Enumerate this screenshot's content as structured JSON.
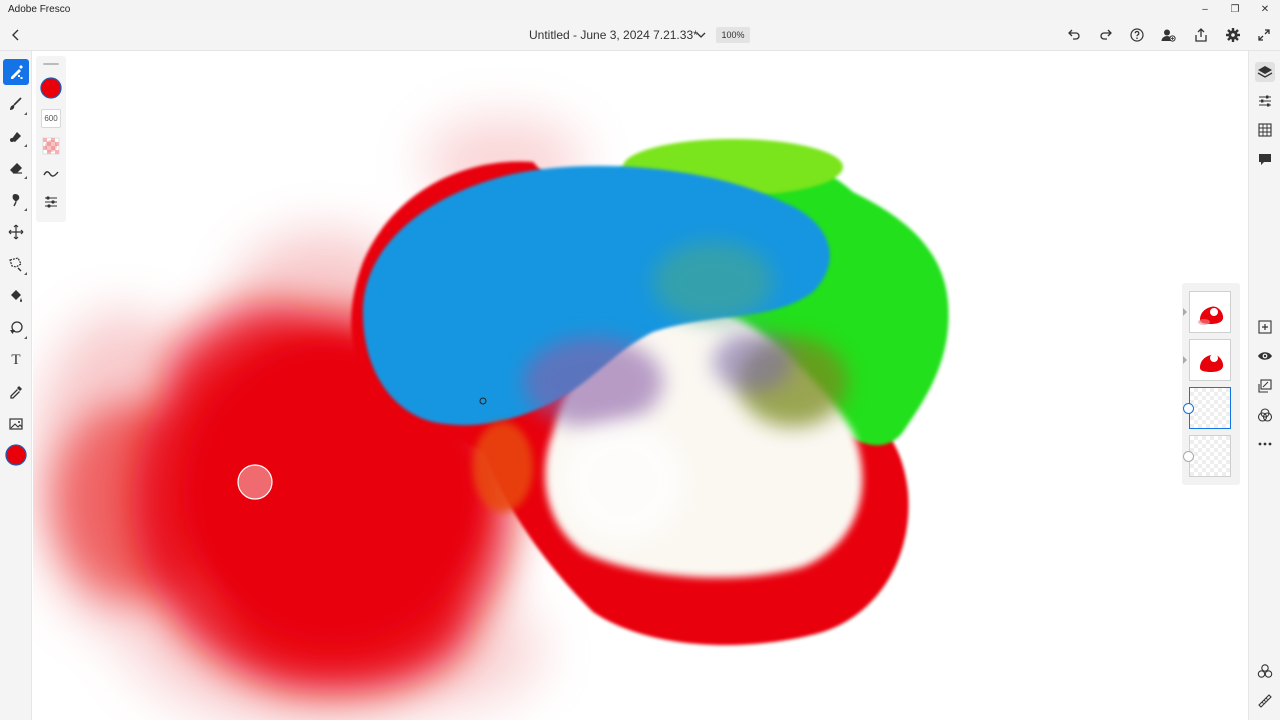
{
  "window": {
    "app_title": "Adobe Fresco",
    "minimize_glyph": "–",
    "maximize_glyph": "❐",
    "close_glyph": "✕"
  },
  "header": {
    "document_title": "Untitled - June 3, 2024 7.21.33*",
    "zoom_level": "100%"
  },
  "brush_settings": {
    "brush_size": "600",
    "color": "#e8000b"
  },
  "left_toolbar": {
    "tools": [
      {
        "name": "pixel-brush-tool",
        "icon": "pixel-brush-icon",
        "active": true
      },
      {
        "name": "live-brush-tool",
        "icon": "live-brush-icon",
        "active": false
      },
      {
        "name": "vector-brush-tool",
        "icon": "vector-brush-icon",
        "active": false
      },
      {
        "name": "eraser-tool",
        "icon": "eraser-icon",
        "active": false
      },
      {
        "name": "smudge-tool",
        "icon": "smudge-icon",
        "active": false
      },
      {
        "name": "transform-tool",
        "icon": "move-icon",
        "active": false
      },
      {
        "name": "lasso-tool",
        "icon": "lasso-icon",
        "active": false
      },
      {
        "name": "fill-tool",
        "icon": "paint-bucket-icon",
        "active": false
      },
      {
        "name": "shapes-tool",
        "icon": "shapes-icon",
        "active": false
      },
      {
        "name": "type-tool",
        "icon": "type-icon",
        "active": false
      },
      {
        "name": "eyedropper-tool",
        "icon": "eyedropper-icon",
        "active": false
      },
      {
        "name": "place-image-tool",
        "icon": "image-icon",
        "active": false
      }
    ],
    "type_glyph": "T"
  },
  "colors": {
    "accent": "#1473e6",
    "paint_red": "#e8000b",
    "paint_blue": "#1896e0",
    "paint_green": "#22e01a",
    "panel_bg": "#f4f4f4"
  },
  "layers": {
    "count": 4,
    "selected_index": 2
  }
}
